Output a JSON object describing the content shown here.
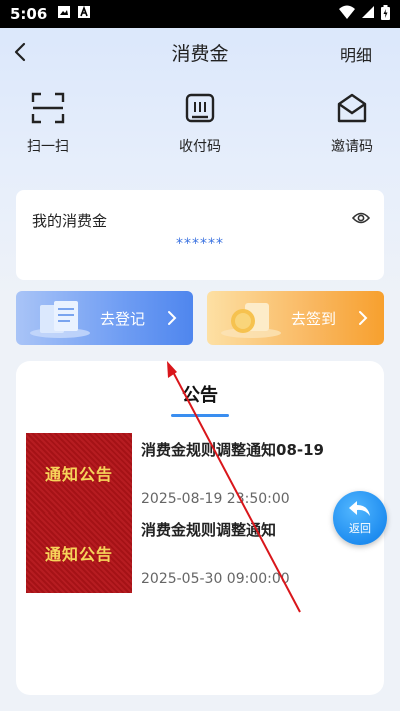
{
  "status_bar": {
    "time": "5:06"
  },
  "header": {
    "title": "消费金",
    "detail_label": "明细"
  },
  "quick_actions": [
    {
      "label": "扫一扫",
      "icon": "scan-icon"
    },
    {
      "label": "收付码",
      "icon": "payment-code-icon"
    },
    {
      "label": "邀请码",
      "icon": "invite-mail-icon"
    }
  ],
  "balance": {
    "label": "我的消费金",
    "value": "******"
  },
  "actions": {
    "register_label": "去登记",
    "signin_label": "去签到"
  },
  "notices": {
    "title": "公告",
    "items": [
      {
        "thumb_text": "通知公告",
        "title": "消费金规则调整通知08-19",
        "date": "2025-08-19 23:50:00"
      },
      {
        "thumb_text": "通知公告",
        "title": "消费金规则调整通知",
        "date": "2025-05-30 09:00:00"
      }
    ]
  },
  "float_back_label": "返回",
  "colors": {
    "accent": "#3a8ef0",
    "register_btn": "#4f86ee",
    "signin_btn": "#f7a02e",
    "thumb_red": "#b31318"
  }
}
